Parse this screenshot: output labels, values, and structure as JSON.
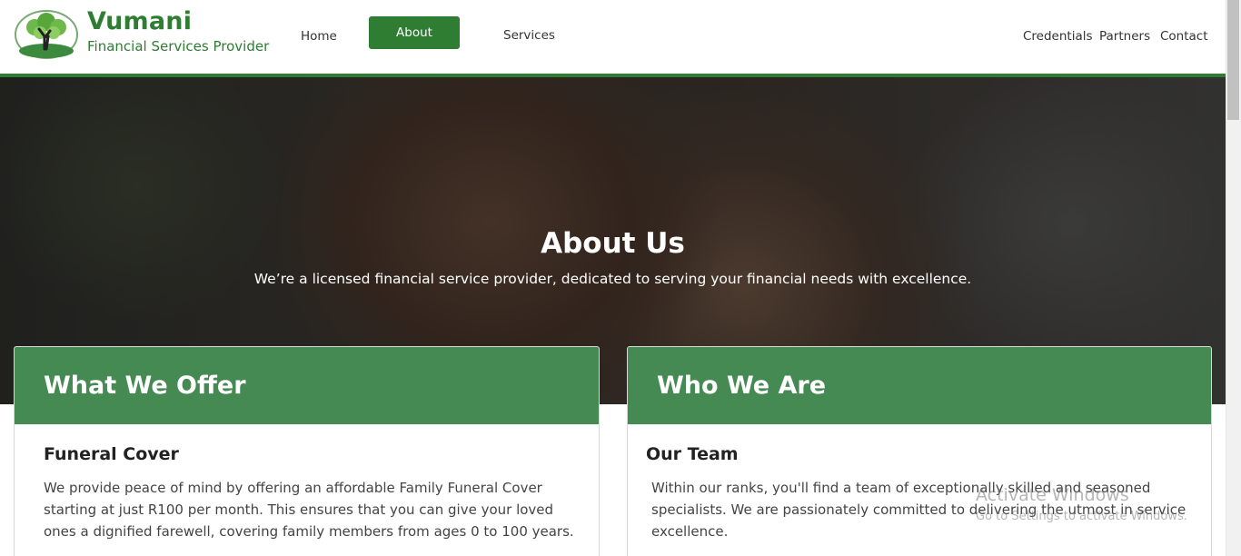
{
  "brand": {
    "name": "Vumani",
    "tagline": "Financial Services Provider"
  },
  "nav": {
    "home": "Home",
    "about": "About",
    "services": "Services",
    "credentials": "Credentials",
    "partners": "Partners",
    "contact": "Contact"
  },
  "hero": {
    "title": "About Us",
    "subtitle": "We’re a licensed financial service provider, dedicated to serving your financial needs with excellence."
  },
  "offer": {
    "heading": "What We Offer",
    "subheading": "Funeral Cover",
    "text": "We provide peace of mind by offering an affordable Family Funeral Cover starting at just R100 per month. This ensures that you can give your loved ones a dignified farewell, covering family members from ages 0 to 100 years."
  },
  "who": {
    "heading": "Who We Are",
    "subheading": "Our Team",
    "text": "Within our ranks, you'll find a team of exceptionally skilled and seasoned specialists. We are passionately committed to delivering the utmost in service excellence."
  },
  "watermark": {
    "title": "Activate Windows",
    "subtitle": "Go to Settings to activate Windows."
  },
  "colors": {
    "accent": "#2e7d32",
    "card_header": "#448a52"
  }
}
